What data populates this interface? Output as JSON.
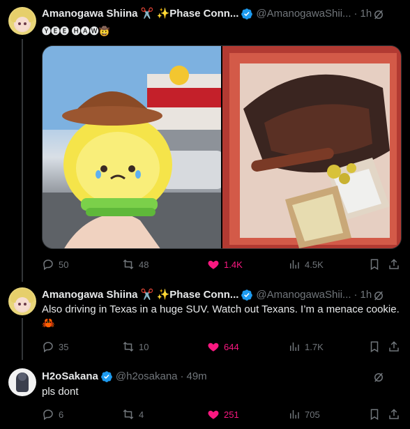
{
  "tweets": [
    {
      "name": "Amanogawa Shiina ✂️ ✨Phase Conn...",
      "handle": "@AmanogawaShii...",
      "time": "1h",
      "text": "🅨🅔🅔 🅗🅐🅦🤠",
      "replies": "50",
      "retweets": "48",
      "likes": "1.4K",
      "views": "4.5K"
    },
    {
      "name": "Amanogawa Shiina ✂️ ✨Phase Conn...",
      "handle": "@AmanogawaShii...",
      "time": "1h",
      "text": "Also driving in Texas in a huge SUV. Watch out Texans. I’m a menace cookie. 🦀",
      "replies": "35",
      "retweets": "10",
      "likes": "644",
      "views": "1.7K"
    },
    {
      "name": "H2oSakana",
      "handle": "@h2osakana",
      "time": "49m",
      "text": "pls dont",
      "replies": "6",
      "retweets": "4",
      "likes": "251",
      "views": "705"
    }
  ],
  "colors": {
    "accent_like": "#f91880",
    "verified": "#1d9bf0",
    "muted": "#71767b"
  },
  "icons": [
    "verified-badge-icon",
    "grok-icon",
    "reply-icon",
    "retweet-icon",
    "heart-icon",
    "views-icon",
    "bookmark-icon",
    "share-icon"
  ]
}
